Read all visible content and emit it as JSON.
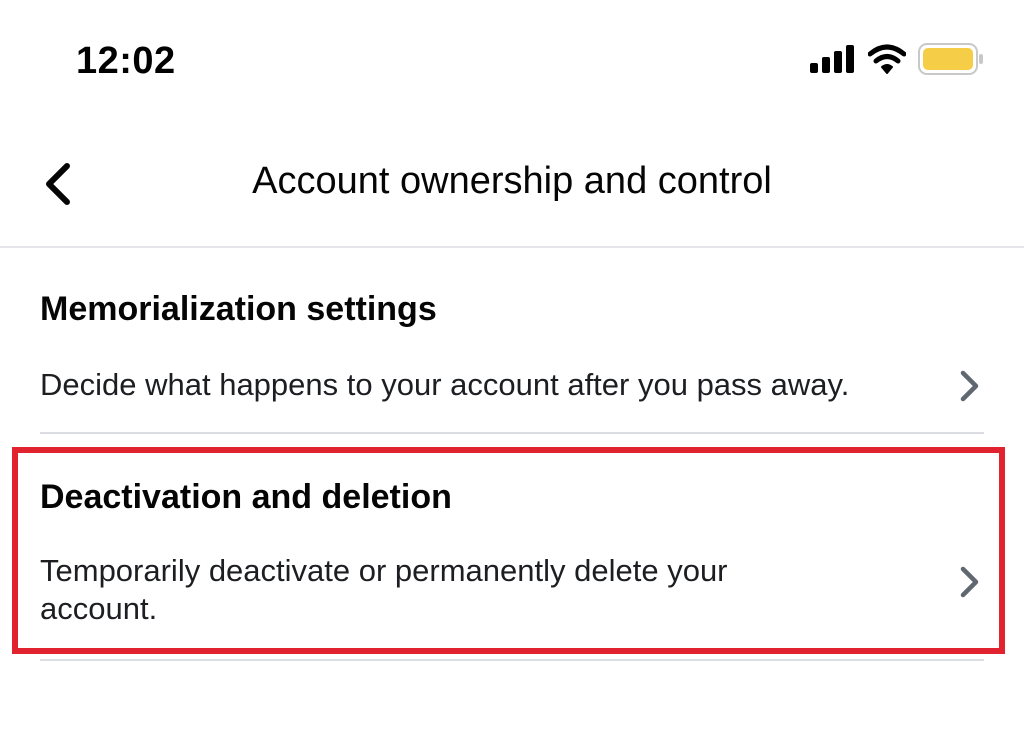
{
  "status_bar": {
    "time": "12:02",
    "icons": [
      "signal-icon",
      "wifi-icon",
      "battery-icon"
    ],
    "battery_color": "#f5cd47"
  },
  "header": {
    "back_icon": "chevron-left-icon",
    "title": "Account ownership and control"
  },
  "items": [
    {
      "title": "Memorialization settings",
      "description": "Decide what happens to your account after you pass away.",
      "icon": "chevron-right-icon"
    },
    {
      "title": "Deactivation and deletion",
      "description": "Temporarily deactivate or permanently delete your account.",
      "icon": "chevron-right-icon",
      "highlighted": true
    }
  ],
  "colors": {
    "highlight": "#e0232f",
    "divider": "#dadde1",
    "chevron": "#606770"
  }
}
